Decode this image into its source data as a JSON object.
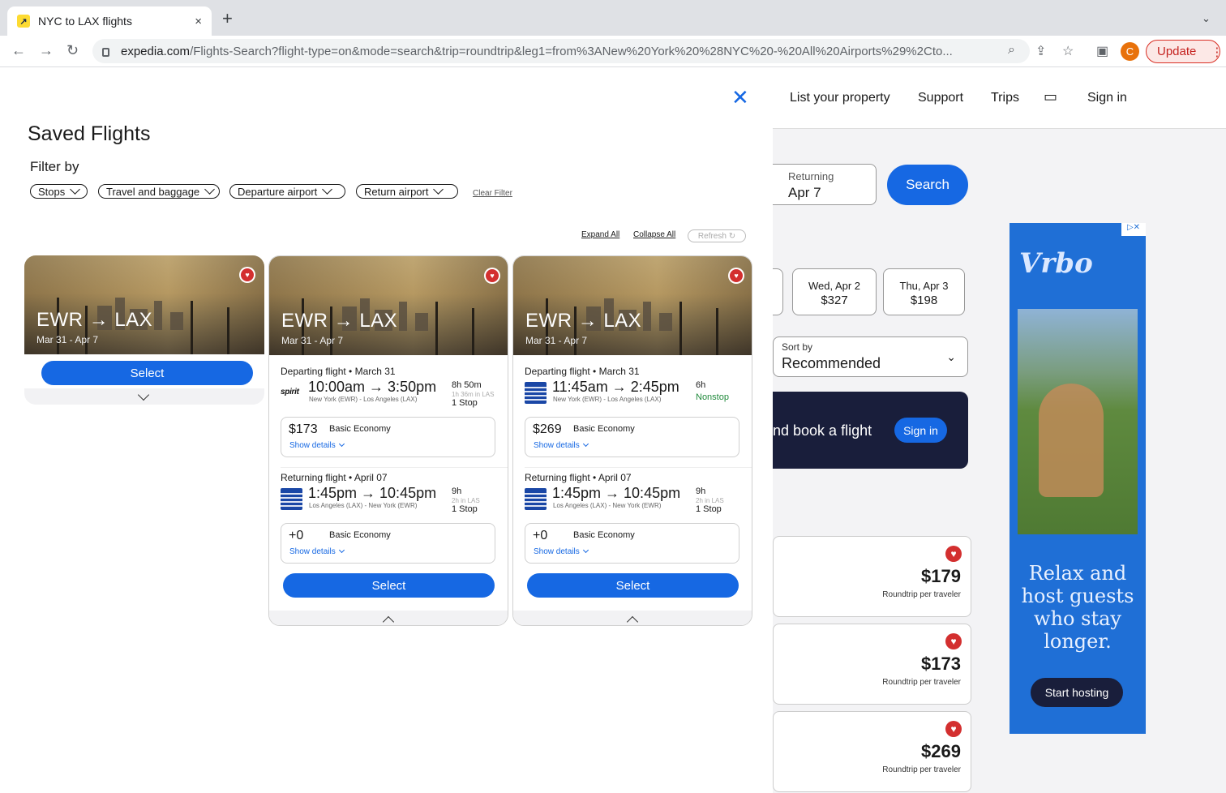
{
  "browser": {
    "tab_title": "NYC to LAX flights",
    "tab_close": "×",
    "new_tab": "+",
    "url_domain": "expedia.com",
    "url_path": "/Flights-Search?flight-type=on&mode=search&trip=roundtrip&leg1=from%3ANew%20York%20%28NYC%20-%20All%20Airports%29%2Cto...",
    "profile_initial": "C",
    "update_label": "Update"
  },
  "background": {
    "nav": [
      "List your property",
      "Support",
      "Trips",
      "Sign in"
    ],
    "returning_label": "Returning",
    "returning_value": "Apr 7",
    "search_label": "Search",
    "date_cards": [
      {
        "day": "Wed, Apr 2",
        "price": "$327"
      },
      {
        "day": "Thu, Apr 3",
        "price": "$198"
      }
    ],
    "sort_label": "Sort by",
    "sort_value": "Recommended",
    "promo_text": "nd book a flight",
    "promo_signin": "Sign in",
    "price_cards": [
      {
        "price": "$179",
        "sub": "Roundtrip per traveler"
      },
      {
        "price": "$173",
        "sub": "Roundtrip per traveler"
      },
      {
        "price": "$269",
        "sub": "Roundtrip per traveler"
      }
    ],
    "ad": {
      "brand": "Vrbo",
      "tagline": "Relax and host guests who stay longer.",
      "cta": "Start hosting"
    }
  },
  "modal": {
    "title": "Saved Flights",
    "filter_by": "Filter by",
    "filters": [
      "Stops",
      "Travel and baggage",
      "Departure airport",
      "Return airport"
    ],
    "clear_filter": "Clear Filter",
    "expand_all": "Expand All",
    "collapse_all": "Collapse All",
    "refresh": "Refresh ↻",
    "cards": [
      {
        "route": "EWR → LAX",
        "dates": "Mar 31 - Apr 7",
        "select": "Select"
      },
      {
        "route": "EWR → LAX",
        "dates": "Mar 31 - Apr 7",
        "select": "Select",
        "departing": {
          "label": "Departing flight • March 31",
          "airline_logo": "spirit",
          "times": "10:00am → 3:50pm",
          "airports": "New York (EWR) - Los Angeles (LAX)",
          "duration": "8h 50m",
          "layover": "1h 36m in LAS",
          "stops": "1 Stop",
          "price": "$173",
          "fare_class": "Basic Economy",
          "show_details": "Show details"
        },
        "returning": {
          "label": "Returning flight • April 07",
          "airline_logo": "united",
          "times": "1:45pm → 10:45pm",
          "airports": "Los Angeles (LAX) - New York (EWR)",
          "duration": "9h",
          "layover": "2h in LAS",
          "stops": "1 Stop",
          "price": "+0",
          "fare_class": "Basic Economy",
          "show_details": "Show details"
        }
      },
      {
        "route": "EWR → LAX",
        "dates": "Mar 31 - Apr 7",
        "select": "Select",
        "departing": {
          "label": "Departing flight • March 31",
          "airline_logo": "united",
          "times": "11:45am → 2:45pm",
          "airports": "New York (EWR) - Los Angeles (LAX)",
          "duration": "6h",
          "layover": "",
          "stops": "Nonstop",
          "price": "$269",
          "fare_class": "Basic Economy",
          "show_details": "Show details"
        },
        "returning": {
          "label": "Returning flight • April 07",
          "airline_logo": "united",
          "times": "1:45pm → 10:45pm",
          "airports": "Los Angeles (LAX) - New York (EWR)",
          "duration": "9h",
          "layover": "2h in LAS",
          "stops": "1 Stop",
          "price": "+0",
          "fare_class": "Basic Economy",
          "show_details": "Show details"
        }
      }
    ]
  },
  "colors": {
    "accent": "#1668e3",
    "heart": "#d32f2f",
    "nonstop": "#218a3c"
  }
}
